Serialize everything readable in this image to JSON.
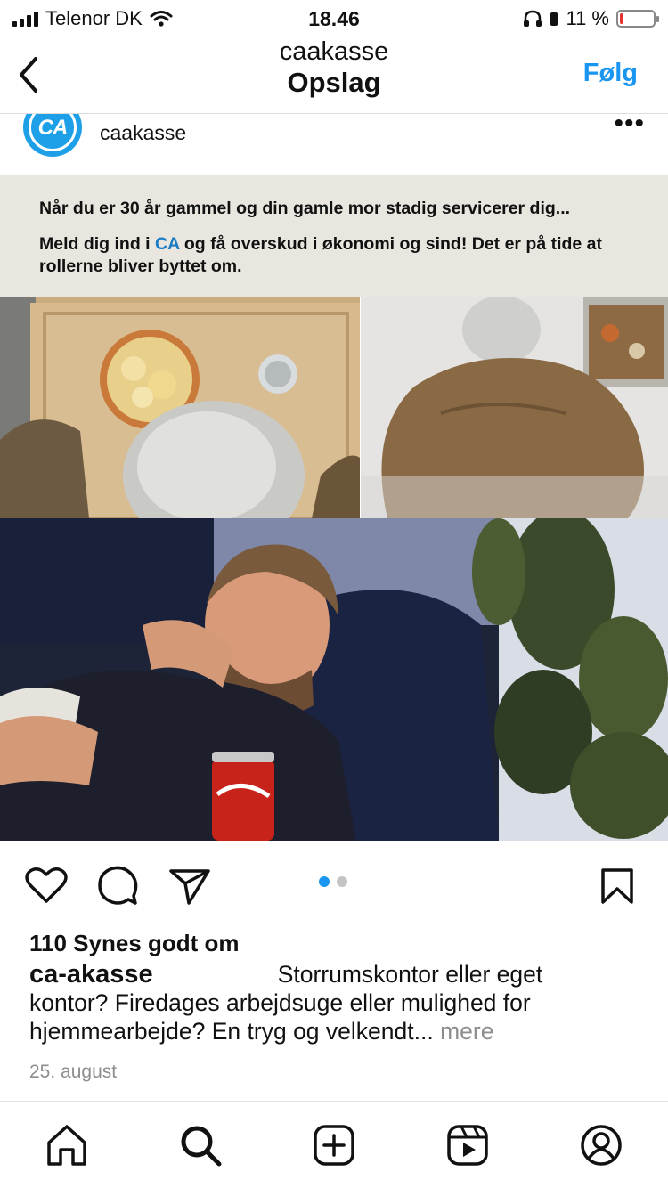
{
  "status_bar": {
    "carrier": "Telenor DK",
    "time": "18.46",
    "battery_percent": "11 %",
    "battery_level": 0.11
  },
  "header": {
    "subtitle": "caakasse",
    "title": "Opslag",
    "follow_label": "Følg"
  },
  "post": {
    "avatar_text": "CA",
    "username": "caakasse",
    "more_label": "•••",
    "panel_line1": "Når du er 30 år gammel og din gamle mor stadig servicerer dig...",
    "panel_line2_a": "Meld dig ind i ",
    "panel_line2_brand": "CA",
    "panel_line2_b": " og få overskud i økonomi og sind! Det er på tide at rollerne bliver byttet om.",
    "likes": "110 Synes godt om",
    "caption_user": "ca-akasse",
    "caption_text": "Storrumskontor eller eget kontor? Firedages arbejdsuge eller mulighed for hjemmearbejde? En tryg og velkendt...",
    "caption_more": "mere",
    "date": "25. august",
    "carousel_active": 1,
    "carousel_total": 2
  },
  "icons": {
    "like": "heart-icon",
    "comment": "comment-icon",
    "share": "send-icon",
    "save": "bookmark-icon"
  },
  "tabs": [
    "home-icon",
    "search-icon",
    "create-icon",
    "reels-icon",
    "profile-icon"
  ],
  "colors": {
    "accent": "#1a96f0",
    "brand": "#1b7cc4",
    "panel_bg": "#e8e6df",
    "battery_low": "#e8322f"
  }
}
